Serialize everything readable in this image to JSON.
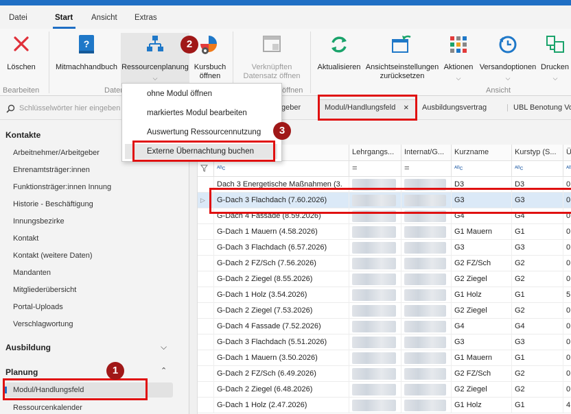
{
  "menu": {
    "tabs": [
      "Datei",
      "Start",
      "Ansicht",
      "Extras"
    ]
  },
  "ribbon": {
    "loeschen": "Löschen",
    "mitmach": "Mitmachhandbuch",
    "ressourcen": "Ressourcenplanung",
    "kursbuch_1": "Kursbuch",
    "kursbuch_2": "öffnen",
    "verkn_1": "Verknüpften",
    "verkn_2": "Datensatz öffnen",
    "aktualisieren": "Aktualisieren",
    "ansicht_1": "Ansichtseinstellungen",
    "ansicht_2": "zurücksetzen",
    "aktionen": "Aktionen",
    "versand": "Versandoptionen",
    "drucken": "Drucken",
    "groups": {
      "bearbeiten": "Bearbeiten",
      "daten": "Daten",
      "oeffnen": "öffnen",
      "ansicht": "Ansicht"
    }
  },
  "dropdown": {
    "items": [
      "ohne Modul öffnen",
      "markiertes Modul bearbeiten",
      "Auswertung Ressourcennutzung",
      "Externe Übernachtung buchen"
    ]
  },
  "search": {
    "placeholder": "Schlüsselwörter hier eingeben"
  },
  "sidebar": {
    "kontakte": "Kontakte",
    "kontakte_items": [
      "Arbeitnehmer/Arbeitgeber",
      "Ehrenamtsträger:innen",
      "Funktionsträger:innen Innung",
      "Historie - Beschäftigung",
      "Innungsbezirke",
      "Kontakt",
      "Kontakt (weitere Daten)",
      "Mandanten",
      "Mitgliederübersicht",
      "Portal-Uploads",
      "Verschlagwortung"
    ],
    "ausbildung": "Ausbildung",
    "planung": "Planung",
    "planung_items": [
      "Modul/Handlungsfeld",
      "Ressourcenkalender"
    ]
  },
  "doctabs": {
    "prev": "geber",
    "active": "Modul/Handlungsfeld",
    "close": "×",
    "t2": "Ausbildungsvertrag",
    "t3": "UBL Benotung Vo"
  },
  "badges": [
    "1",
    "2",
    "3"
  ],
  "grid": {
    "headers": [
      "Lehrgangs...",
      "Internat/G...",
      "Kurzname",
      "Kurstyp (S...",
      "Ü"
    ],
    "filter_eq": "=",
    "filter_abc": "ᴬᴮc",
    "rows": [
      {
        "name": "Dach 3 Energetische Maßnahmen (3.",
        "kurz": "D3",
        "typ": "D3",
        "u": "0"
      },
      {
        "name": "G-Dach 3 Flachdach (7.60.2026)",
        "kurz": "G3",
        "typ": "G3",
        "u": "0"
      },
      {
        "name": "G-Dach 4 Fassade (8.59.2026)",
        "kurz": "G4",
        "typ": "G4",
        "u": "0"
      },
      {
        "name": "G-Dach 1 Mauern (4.58.2026)",
        "kurz": "G1 Mauern",
        "typ": "G1",
        "u": "0"
      },
      {
        "name": "G-Dach 3 Flachdach (6.57.2026)",
        "kurz": "G3",
        "typ": "G3",
        "u": "0"
      },
      {
        "name": "G-Dach 2 FZ/Sch (7.56.2026)",
        "kurz": "G2 FZ/Sch",
        "typ": "G2",
        "u": "0"
      },
      {
        "name": "G-Dach 2 Ziegel (8.55.2026)",
        "kurz": "G2 Ziegel",
        "typ": "G2",
        "u": "0"
      },
      {
        "name": "G-Dach 1 Holz (3.54.2026)",
        "kurz": "G1 Holz",
        "typ": "G1",
        "u": "5"
      },
      {
        "name": "G-Dach 2 Ziegel (7.53.2026)",
        "kurz": "G2 Ziegel",
        "typ": "G2",
        "u": "0"
      },
      {
        "name": "G-Dach 4 Fassade (7.52.2026)",
        "kurz": "G4",
        "typ": "G4",
        "u": "0"
      },
      {
        "name": "G-Dach 3 Flachdach (5.51.2026)",
        "kurz": "G3",
        "typ": "G3",
        "u": "0"
      },
      {
        "name": "G-Dach 1 Mauern (3.50.2026)",
        "kurz": "G1 Mauern",
        "typ": "G1",
        "u": "0"
      },
      {
        "name": "G-Dach 2 FZ/Sch (6.49.2026)",
        "kurz": "G2 FZ/Sch",
        "typ": "G2",
        "u": "0"
      },
      {
        "name": "G-Dach 2 Ziegel (6.48.2026)",
        "kurz": "G2 Ziegel",
        "typ": "G2",
        "u": "0"
      },
      {
        "name": "G-Dach 1 Holz (2.47.2026)",
        "kurz": "G1 Holz",
        "typ": "G1",
        "u": "4"
      }
    ]
  },
  "colors": {
    "accent": "#1f6fc4",
    "highlight": "#e01010",
    "badge": "#a01818"
  }
}
